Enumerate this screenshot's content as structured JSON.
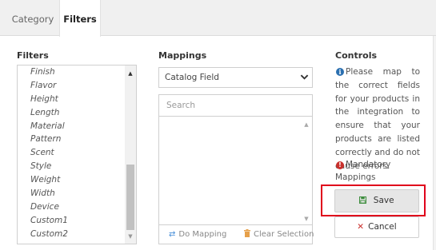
{
  "tabs": [
    {
      "label": "Category",
      "active": false
    },
    {
      "label": "Filters",
      "active": true
    }
  ],
  "filters": {
    "title": "Filters",
    "items": [
      "Finish",
      "Flavor",
      "Height",
      "Length",
      "Material",
      "Pattern",
      "Scent",
      "Style",
      "Weight",
      "Width",
      "Device",
      "Custom1",
      "Custom2"
    ]
  },
  "mappings": {
    "title": "Mappings",
    "select_value": "Catalog Field",
    "search_placeholder": "Search",
    "do_mapping_label": "Do Mapping",
    "clear_selection_label": "Clear Selection"
  },
  "controls": {
    "title": "Controls",
    "info_text": "Please map to the correct fields for your products in the integration to ensure that your products are listed correctly and do not cause errors.",
    "mandatory_text": "Mandatory Mappings",
    "save_label": "Save",
    "cancel_label": "Cancel"
  },
  "colors": {
    "highlight": "#e0001b",
    "info_icon": "#2a6fb0",
    "warning_icon": "#c9302c",
    "save_icon": "#3c8d3c"
  },
  "icons": {
    "info": "info-circle-icon",
    "warning": "exclamation-circle-icon",
    "save": "floppy-disk-icon",
    "cancel": "times-icon",
    "do_mapping": "exchange-icon",
    "clear_selection": "trash-icon",
    "select": "chevron-down-icon"
  }
}
